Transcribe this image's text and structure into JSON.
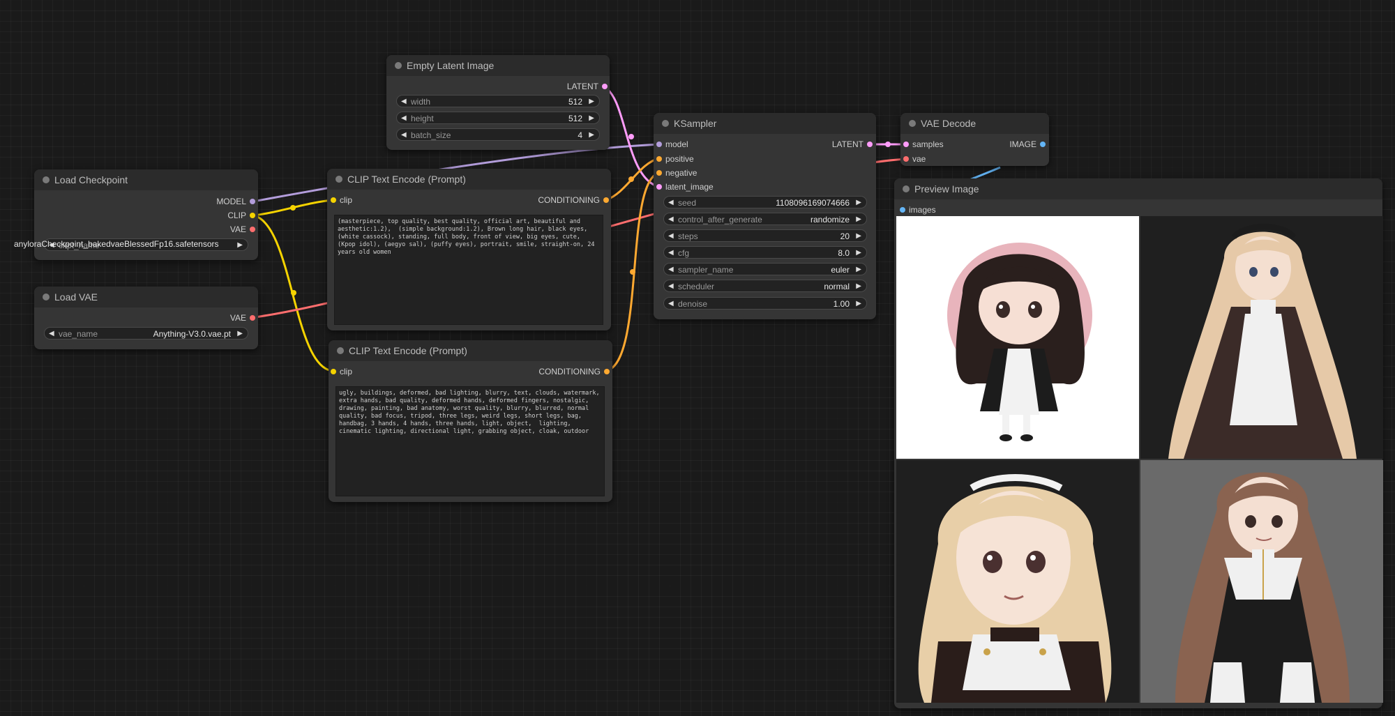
{
  "colors": {
    "background": "#1a1a1a",
    "node_body": "#353535",
    "node_title": "#2b2b2b",
    "slot_model": "#b39ddb",
    "slot_clip": "#f5d300",
    "slot_vae": "#ff6e6e",
    "slot_latent": "#ff9cf9",
    "slot_conditioning": "#ffa931",
    "slot_image": "#64b5f6"
  },
  "nodes": {
    "load_checkpoint": {
      "title": "Load Checkpoint",
      "outputs": [
        "MODEL",
        "CLIP",
        "VAE"
      ],
      "widget": {
        "name": "ckpt_name",
        "value": "anyloraCheckpoint_bakedvaeBlessedFp16.safetensors"
      }
    },
    "load_vae": {
      "title": "Load VAE",
      "outputs": [
        "VAE"
      ],
      "widget": {
        "name": "vae_name",
        "value": "Anything-V3.0.vae.pt"
      }
    },
    "empty_latent": {
      "title": "Empty Latent Image",
      "outputs": [
        "LATENT"
      ],
      "widgets": [
        {
          "name": "width",
          "value": "512"
        },
        {
          "name": "height",
          "value": "512"
        },
        {
          "name": "batch_size",
          "value": "4"
        }
      ]
    },
    "clip_positive": {
      "title": "CLIP Text Encode (Prompt)",
      "input": "clip",
      "output": "CONDITIONING",
      "text": "(masterpiece, top quality, best quality, official art, beautiful and aesthetic:1.2),  (simple background:1.2), Brown long hair, black eyes, (white cassock), standing, full body, front of view, big eyes, cute, (Kpop idol), (aegyo sal), (puffy eyes), portrait, smile, straight-on, 24 years old women"
    },
    "clip_negative": {
      "title": "CLIP Text Encode (Prompt)",
      "input": "clip",
      "output": "CONDITIONING",
      "text": "ugly, buildings, deformed, bad lighting, blurry, text, clouds, watermark, extra hands, bad quality, deformed hands, deformed fingers, nostalgic, drawing, painting, bad anatomy, worst quality, blurry, blurred, normal quality, bad focus, tripod, three legs, weird legs, short legs, bag, handbag, 3 hands, 4 hands, three hands, light, object,  lighting, cinematic lighting, directional light, grabbing object, cloak, outdoor"
    },
    "ksampler": {
      "title": "KSampler",
      "inputs": [
        "model",
        "positive",
        "negative",
        "latent_image"
      ],
      "output": "LATENT",
      "widgets": [
        {
          "name": "seed",
          "value": "1108096169074666"
        },
        {
          "name": "control_after_generate",
          "value": "randomize"
        },
        {
          "name": "steps",
          "value": "20"
        },
        {
          "name": "cfg",
          "value": "8.0"
        },
        {
          "name": "sampler_name",
          "value": "euler"
        },
        {
          "name": "scheduler",
          "value": "normal"
        },
        {
          "name": "denoise",
          "value": "1.00"
        }
      ]
    },
    "vae_decode": {
      "title": "VAE Decode",
      "inputs": [
        "samples",
        "vae"
      ],
      "output": "IMAGE"
    },
    "preview": {
      "title": "Preview Image",
      "input": "images",
      "images": [
        {
          "hair": "#2a1f1d",
          "bg": "#ffffff",
          "circle": "#e8b4bc",
          "style": "chibi"
        },
        {
          "hair": "#e6c9a8",
          "bg": "#1f1f1f",
          "style": "full"
        },
        {
          "hair": "#e8cfa8",
          "bg": "#1f1f1f",
          "style": "closeup"
        },
        {
          "hair": "#8a6350",
          "bg": "#6a6a6a",
          "style": "full"
        }
      ]
    }
  }
}
